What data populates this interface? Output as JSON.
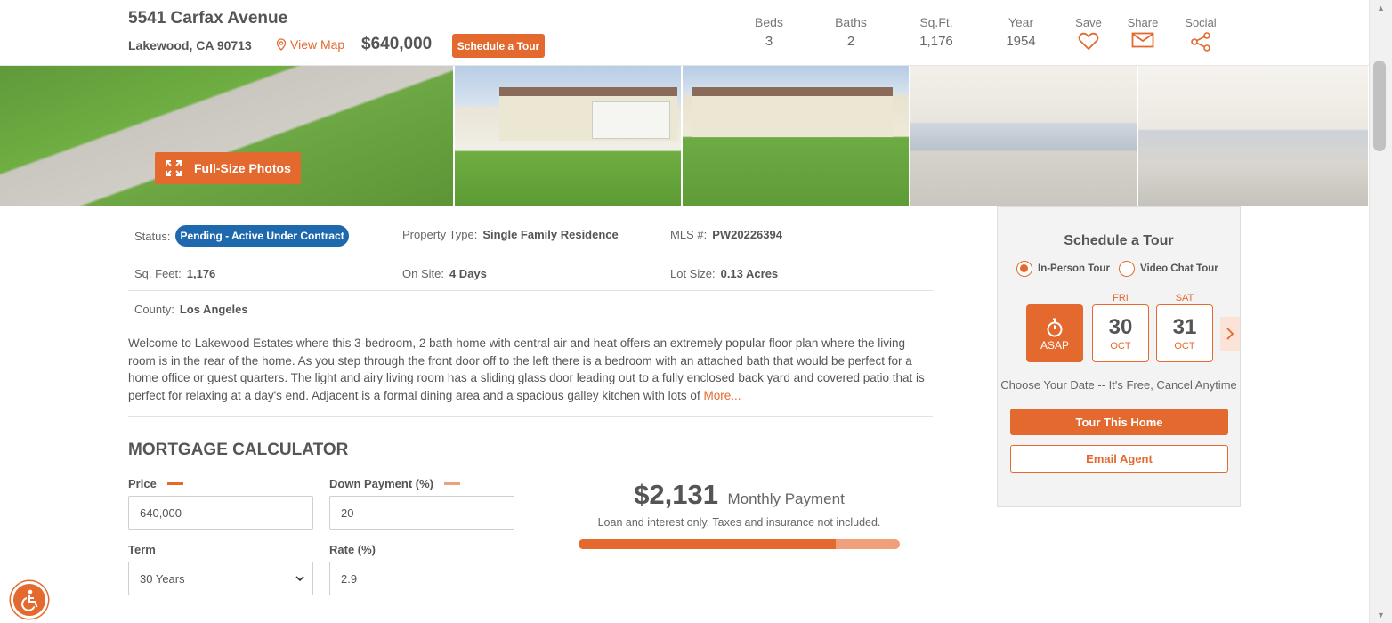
{
  "header": {
    "street": "5541 Carfax Avenue",
    "city": "Lakewood, CA 90713",
    "view_map": "View Map",
    "price": "$640,000",
    "schedule_tour": "Schedule a Tour",
    "stats": [
      {
        "label": "Beds",
        "value": "3"
      },
      {
        "label": "Baths",
        "value": "2"
      },
      {
        "label": "Sq.Ft.",
        "value": "1,176"
      },
      {
        "label": "Year",
        "value": "1954"
      }
    ],
    "actions": {
      "save": "Save",
      "share": "Share",
      "social": "Social"
    }
  },
  "photos": {
    "full_size": "Full-Size Photos"
  },
  "details": {
    "status_label": "Status:",
    "status_value": "Pending - Active Under Contract",
    "property_type_label": "Property Type:",
    "property_type_value": "Single Family Residence",
    "mls_label": "MLS #:",
    "mls_value": "PW20226394",
    "sqfeet_label": "Sq. Feet:",
    "sqfeet_value": "1,176",
    "onsite_label": "On Site:",
    "onsite_value": "4 Days",
    "lot_label": "Lot Size:",
    "lot_value": "0.13 Acres",
    "county_label": "County:",
    "county_value": "Los Angeles"
  },
  "description": {
    "text": "Welcome to Lakewood Estates where this 3-bedroom, 2 bath home with central air and heat offers an extremely popular floor plan where the living room is in the rear of the home. As you step through the front door off to the left there is a bedroom with an attached bath that would be perfect for a home office or guest quarters. The light and airy living room has a sliding glass door leading out to a fully enclosed back yard and covered patio that is perfect for relaxing at a day's end. Adjacent is a formal dining area and a spacious galley kitchen with lots of",
    "more": "More..."
  },
  "mortgage": {
    "title": "MORTGAGE CALCULATOR",
    "price_label": "Price",
    "price_value": "640,000",
    "down_label": "Down Payment (%)",
    "down_value": "20",
    "term_label": "Term",
    "term_value": "30 Years",
    "rate_label": "Rate (%)",
    "rate_value": "2.9",
    "monthly_amount": "$2,131",
    "monthly_label": "Monthly Payment",
    "note": "Loan and interest only. Taxes and insurance not included.",
    "principal_interest_share": 0.8
  },
  "tour": {
    "title": "Schedule a Tour",
    "in_person": "In-Person Tour",
    "video_chat": "Video Chat Tour",
    "selected_mode": "in_person",
    "asap": "ASAP",
    "days": [
      {
        "weekday": "FRI",
        "day": "30",
        "month": "OCT"
      },
      {
        "weekday": "SAT",
        "day": "31",
        "month": "OCT"
      }
    ],
    "choose": "Choose Your Date -- It's Free, Cancel Anytime",
    "tour_btn": "Tour This Home",
    "email_btn": "Email Agent"
  },
  "colors": {
    "accent": "#e3692f",
    "status_badge": "#1e68ad"
  }
}
